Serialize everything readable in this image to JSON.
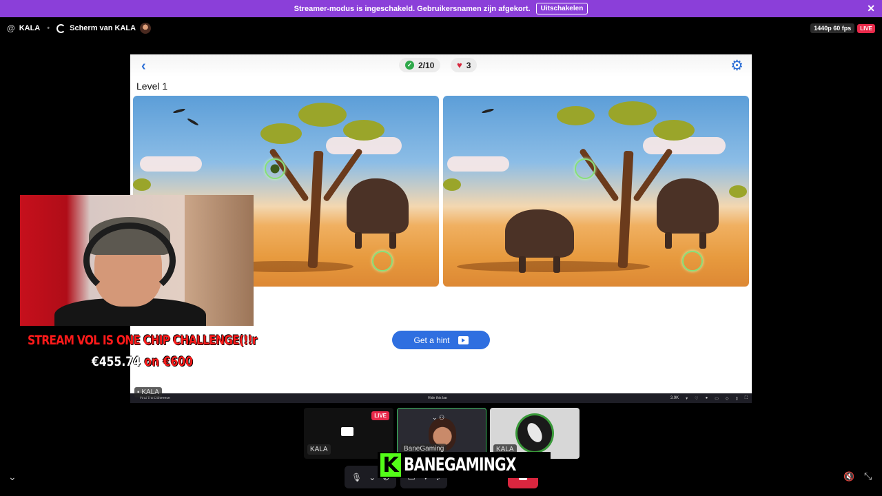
{
  "banner": {
    "message": "Streamer-modus is ingeschakeld. Gebruikersnamen zijn afgekort.",
    "disable_label": "Uitschakelen"
  },
  "header": {
    "channel": "KALA",
    "screen_label": "Scherm van KALA",
    "quality": "1440p 60 fps",
    "live": "LIVE"
  },
  "game": {
    "score": "2/10",
    "lives": "3",
    "level": "Level 1",
    "hint_label": "Get a hint",
    "taskbar_app": "Find The Difference",
    "taskbar_center": "Hide this bar",
    "taskbar_likes": "3.9K"
  },
  "overlay": {
    "challenge": "STREAM VOL IS ONE CHIP CHALLENGE(!!r",
    "goal_current": "€455.74",
    "goal_mid": " on ",
    "goal_target": "€600",
    "name_tag": "KALA"
  },
  "tiles": [
    {
      "name": "KALA",
      "live": "LIVE"
    },
    {
      "name": "BaneGaming"
    },
    {
      "name": "KALA"
    }
  ],
  "brand": {
    "letter": "K",
    "name": "BANEGAMINGX",
    "accent": "#53fc18"
  },
  "colors": {
    "banner": "#8b3fd9",
    "hint_button": "#2f6fe0",
    "end_call": "#d9263f",
    "live": "#e8294a"
  }
}
